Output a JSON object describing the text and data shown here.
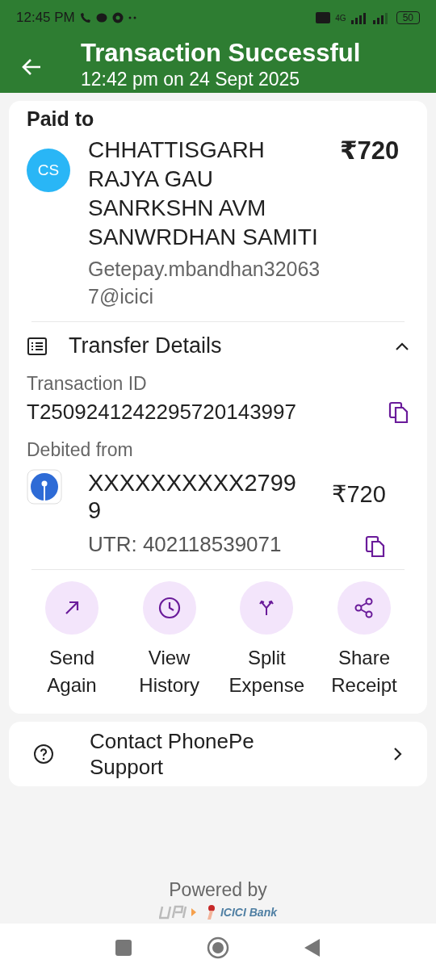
{
  "status_bar": {
    "time": "12:45 PM",
    "network": "4G",
    "battery": "50"
  },
  "header": {
    "title": "Transaction Successful",
    "subtitle": "12:42 pm on 24 Sept 2025"
  },
  "payee": {
    "label": "Paid to",
    "initials": "CS",
    "name": "CHHATTISGARH RAJYA GAU SANRKSHN AVM SANWRDHAN SAMITI",
    "upi_id": "Getepay.mbandhan320637@icici",
    "amount": "₹720"
  },
  "transfer_details": {
    "title": "Transfer Details",
    "expanded": true,
    "transaction_id_label": "Transaction ID",
    "transaction_id": "T2509241242295720143997",
    "debited_label": "Debited from",
    "account": "XXXXXXXXXX27999",
    "amount": "₹720",
    "utr": "UTR: 402118539071"
  },
  "actions": [
    {
      "kind": "send",
      "label": "Send Again"
    },
    {
      "kind": "history",
      "label": "View History"
    },
    {
      "kind": "split",
      "label": "Split Expense"
    },
    {
      "kind": "share",
      "label": "Share Receipt"
    }
  ],
  "support": {
    "label": "Contact PhonePe Support"
  },
  "footer": {
    "powered_by": "Powered by",
    "bank": "ICICI Bank"
  }
}
